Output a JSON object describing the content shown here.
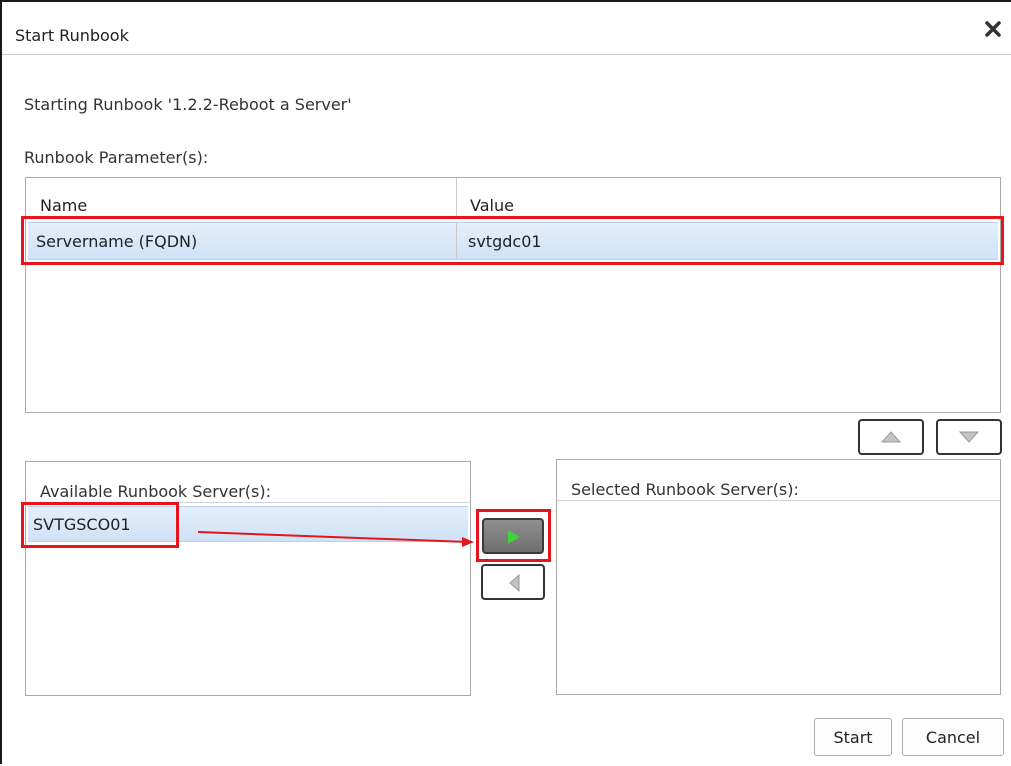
{
  "dialog": {
    "title": "Start Runbook",
    "subtitle": "Starting Runbook '1.2.2-Reboot a Server'"
  },
  "parameters": {
    "label": "Runbook Parameter(s):",
    "columns": [
      "Name",
      "Value"
    ],
    "rows": [
      {
        "name": "Servername (FQDN)",
        "value": "svtgdc01"
      }
    ]
  },
  "available_servers": {
    "title": "Available Runbook Server(s):",
    "items": [
      "SVTGSCO01"
    ]
  },
  "selected_servers": {
    "title": "Selected Runbook Server(s):",
    "items": []
  },
  "buttons": {
    "start": "Start",
    "cancel": "Cancel"
  },
  "icons": {
    "close": "close-icon",
    "move_up": "triangle-up-icon",
    "move_down": "triangle-down-icon",
    "add": "play-arrow-icon",
    "remove": "left-arrow-icon"
  },
  "colors": {
    "highlight": "#e8141c",
    "row_selection": "#cfe2f7",
    "add_arrow": "#3fd13f"
  }
}
